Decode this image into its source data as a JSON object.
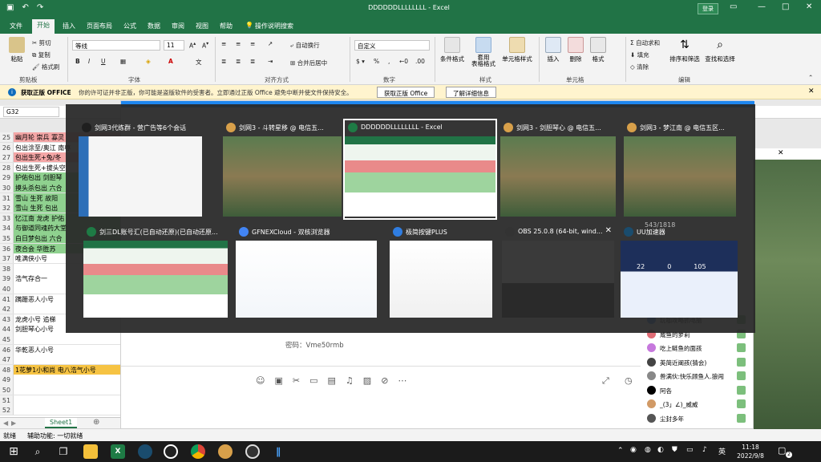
{
  "window": {
    "title": "DDDDDDLLLLLLLL - Excel",
    "login": "登录"
  },
  "ribbon_tabs": [
    "文件",
    "开始",
    "插入",
    "页面布局",
    "公式",
    "数据",
    "审阅",
    "视图",
    "帮助",
    "操作说明搜索"
  ],
  "active_tab_index": 1,
  "ribbon": {
    "clipboard": {
      "paste": "粘贴",
      "cut": "剪切",
      "copy": "复制",
      "format_painter": "格式刷",
      "label": "剪贴板"
    },
    "font": {
      "name": "等线",
      "size": "11",
      "label": "字体",
      "bold": "B",
      "italic": "I",
      "underline": "U"
    },
    "alignment": {
      "wrap": "自动换行",
      "merge": "合并后居中",
      "label": "对齐方式"
    },
    "number": {
      "format": "自定义",
      "label": "数字"
    },
    "styles": {
      "conditional": "条件格式",
      "as_table": "套用\n表格格式",
      "cell_styles": "单元格样式",
      "label": "样式"
    },
    "cells": {
      "insert": "插入",
      "delete": "删除",
      "format": "格式",
      "label": "单元格"
    },
    "editing": {
      "autosum": "自动求和",
      "fill": "填充",
      "clear": "清除",
      "sort": "排序和筛选",
      "find": "查找和选择",
      "label": "编辑"
    }
  },
  "infobar": {
    "title": "获取正版 OFFICE",
    "message": "你的许可证并非正版，你可能是盗版软件的受害者。立即通过正版 Office 避免中断并使文件保持安全。",
    "btn_get": "获取正版 Office",
    "btn_learn": "了解详细信息"
  },
  "namebox": "G32",
  "rows": [
    {
      "n": "25",
      "t": "幽月轮 崇兵 寡灵",
      "bg": "#f4a6a6"
    },
    {
      "n": "26",
      "t": "包出涂至/奥江 南尊",
      "bg": "#ffffff"
    },
    {
      "n": "27",
      "t": "包出生死+兔/冬",
      "bg": "#f4a6a6"
    },
    {
      "n": "28",
      "t": "包出生死+拔头空",
      "bg": "#ffffff"
    },
    {
      "n": "29",
      "t": "护佑包出 剑胆琴",
      "bg": "#8fd18f"
    },
    {
      "n": "30",
      "t": "摸头杀包出 六合",
      "bg": "#8fd18f"
    },
    {
      "n": "31",
      "t": "雪山 生死 故阳",
      "bg": "#8fd18f"
    },
    {
      "n": "32",
      "t": "雪山 生死 包出",
      "bg": "#8fd18f"
    },
    {
      "n": "33",
      "t": "忆江南 龙虎 护佑",
      "bg": "#8fd18f"
    },
    {
      "n": "34",
      "t": "与御道同魂药大堂",
      "bg": "#8fd18f"
    },
    {
      "n": "35",
      "t": "白日梦包出 六合",
      "bg": "#8fd18f"
    },
    {
      "n": "36",
      "t": "夜合会 华胜苏",
      "bg": "#8fd18f"
    },
    {
      "n": "37",
      "t": "唯满侠小号",
      "bg": "#ffffff"
    },
    {
      "n": "38",
      "t": "",
      "bg": "#ffffff"
    },
    {
      "n": "39",
      "t": "浩气存合一",
      "bg": "#ffffff"
    },
    {
      "n": "40",
      "t": "",
      "bg": "#ffffff"
    },
    {
      "n": "41",
      "t": "蹒跚恶人小号",
      "bg": "#ffffff"
    },
    {
      "n": "42",
      "t": "",
      "bg": "#ffffff"
    },
    {
      "n": "43",
      "t": "龙虎小号 追梯",
      "bg": "#ffffff"
    },
    {
      "n": "44",
      "t": "剑胆琴心小号",
      "bg": "#ffffff"
    },
    {
      "n": "45",
      "t": "",
      "bg": "#ffffff"
    },
    {
      "n": "46",
      "t": "华乾恶人小号",
      "bg": "#ffffff"
    },
    {
      "n": "47",
      "t": "",
      "bg": "#ffffff"
    },
    {
      "n": "48",
      "t": "1花萝1小和尚 电八浩气小号",
      "bg": "#f6c343"
    },
    {
      "n": "49",
      "t": "",
      "bg": "#ffffff"
    },
    {
      "n": "50",
      "t": "",
      "bg": "#ffffff"
    },
    {
      "n": "51",
      "t": "",
      "bg": "#ffffff"
    },
    {
      "n": "52",
      "t": "",
      "bg": "#ffffff"
    }
  ],
  "sheet_tab": "Sheet1",
  "status": {
    "ready": "就绪",
    "accessibility": "辅助功能: 一切就绪"
  },
  "chat": {
    "password_label": "密码：Vme50rmb",
    "members": [
      "玩咖攻略抓电脑",
      "咸鱼的萝莉",
      "吃上鲢鱼的面孩",
      "英简近阐孩(猜会)",
      "兽满伙:快乐顾鱼人.狼闯",
      "阿各",
      "_(3」∠)_威威",
      "尘封多年"
    ]
  },
  "switcher": {
    "row1": [
      {
        "label": "剑网3代练群 - 营广告等6个会话",
        "icon": "qq"
      },
      {
        "label": "剑网3 - 斗转星移 @ 电信五...",
        "icon": "game"
      },
      {
        "label": "DDDDDDLLLLLLLL - Excel",
        "icon": "excel"
      },
      {
        "label": "剑网3 - 剑胆琴心 @ 电信五...",
        "icon": "game"
      },
      {
        "label": "剑网3 - 梦江南 @ 电信五区...",
        "icon": "game"
      }
    ],
    "row2": [
      {
        "label": "剑三DL账号汇(已自动还原)(已自动还原...",
        "icon": "excel"
      },
      {
        "label": "GFNEXCloud - 双核浏览器",
        "icon": "chrome"
      },
      {
        "label": "极简按键PLUS",
        "icon": "app"
      },
      {
        "label": "OBS 25.0.8 (64-bit, wind...",
        "icon": "obs"
      },
      {
        "label": "UU加速器",
        "icon": "uu"
      }
    ],
    "selected": "DDDDDDLLLLLLLL - Excel",
    "uu_stats": [
      "22",
      "0",
      "105"
    ],
    "thumb_counter": "543/1818"
  },
  "taskbar": {
    "time": "11:18",
    "date": "2022/9/8",
    "lang": "英",
    "notif": "2"
  }
}
